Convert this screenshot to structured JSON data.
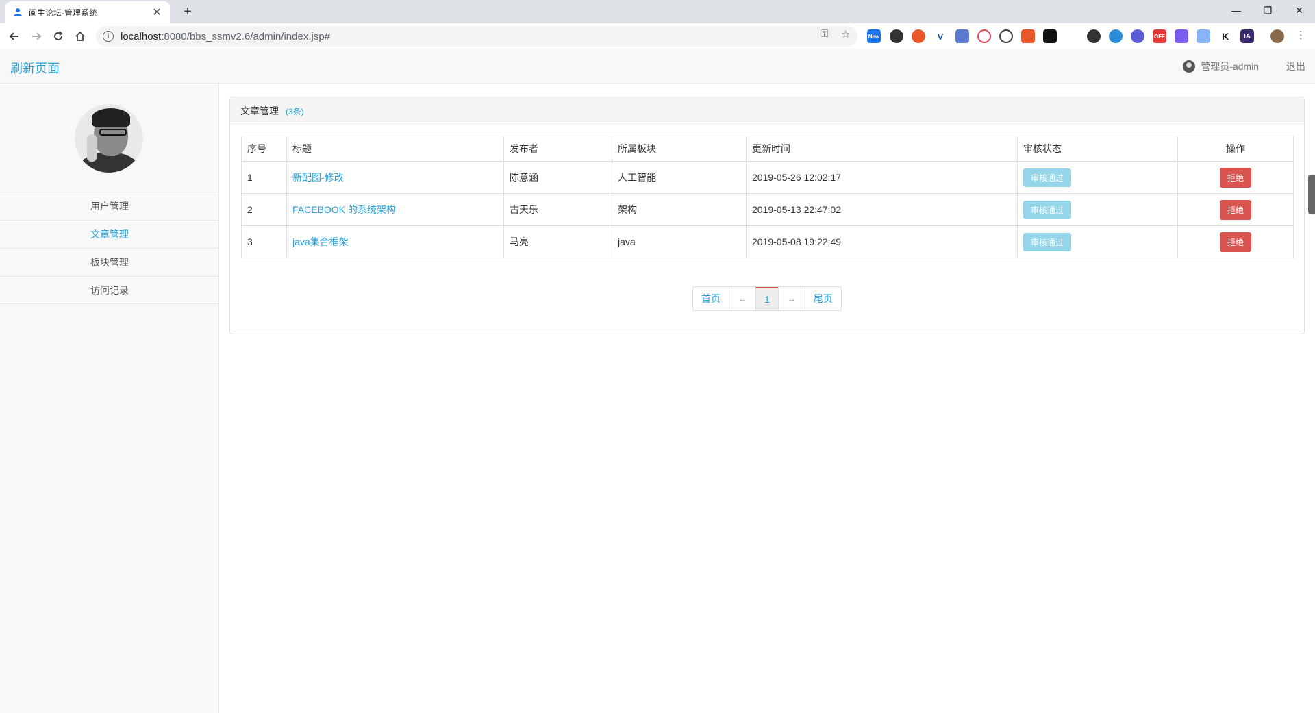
{
  "browser": {
    "tab_title": "闽生论坛-管理系统",
    "tab_close": "✕",
    "new_tab": "+",
    "url_host": "localhost",
    "url_path": ":8080/bbs_ssmv2.6/admin/index.jsp#",
    "window_controls": [
      "—",
      "❐",
      "✕"
    ],
    "extension_badges": [
      "New",
      "OFF",
      "K",
      "IA"
    ]
  },
  "header": {
    "brand": "刷新页面",
    "admin_label": "管理员-admin",
    "logout": "退出"
  },
  "sidebar": {
    "items": [
      {
        "label": "用户管理",
        "active": false
      },
      {
        "label": "文章管理",
        "active": true
      },
      {
        "label": "板块管理",
        "active": false
      },
      {
        "label": "访问记录",
        "active": false
      }
    ]
  },
  "panel": {
    "title": "文章管理",
    "count": "(3条)"
  },
  "table": {
    "headers": [
      "序号",
      "标题",
      "发布者",
      "所属板块",
      "更新时间",
      "审核状态",
      "操作"
    ],
    "rows": [
      {
        "index": "1",
        "title": "新配图-修改",
        "author": "陈意涵",
        "board": "人工智能",
        "updated": "2019-05-26 12:02:17",
        "status": "审核通过",
        "action": "拒绝"
      },
      {
        "index": "2",
        "title": "FACEBOOK 的系统架构",
        "author": "古天乐",
        "board": "架构",
        "updated": "2019-05-13 22:47:02",
        "status": "审核通过",
        "action": "拒绝"
      },
      {
        "index": "3",
        "title": "java集合框架",
        "author": "马亮",
        "board": "java",
        "updated": "2019-05-08 19:22:49",
        "status": "审核通过",
        "action": "拒绝"
      }
    ]
  },
  "pagination": {
    "first": "首页",
    "prev": "←",
    "current": "1",
    "next": "→",
    "last": "尾页"
  },
  "colors": {
    "accent": "#23a0d8",
    "reject": "#d9534f",
    "pass": "#5bc0de"
  }
}
